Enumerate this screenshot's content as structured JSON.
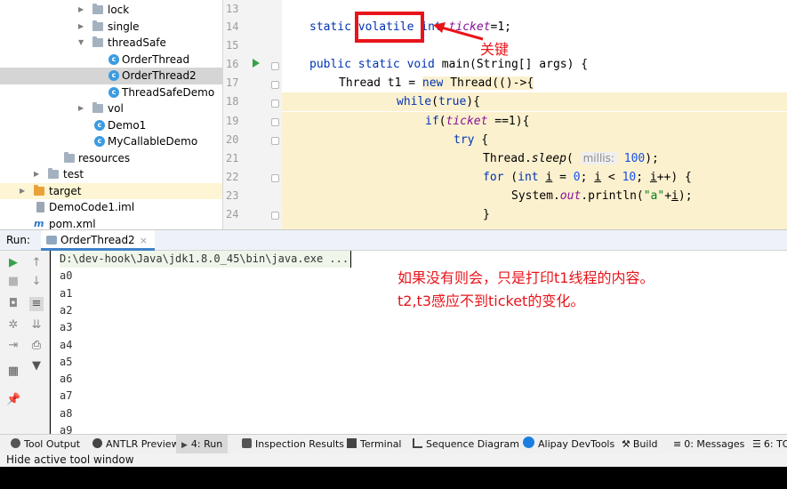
{
  "tree": {
    "items": [
      {
        "label": "lock",
        "kind": "folder"
      },
      {
        "label": "single",
        "kind": "folder"
      },
      {
        "label": "threadSafe",
        "kind": "folder"
      },
      {
        "label": "OrderThread",
        "kind": "class"
      },
      {
        "label": "OrderThread2",
        "kind": "class"
      },
      {
        "label": "ThreadSafeDemo",
        "kind": "class"
      },
      {
        "label": "vol",
        "kind": "folder"
      },
      {
        "label": "Demo1",
        "kind": "class"
      },
      {
        "label": "MyCallableDemo",
        "kind": "class"
      },
      {
        "label": "resources",
        "kind": "folder"
      },
      {
        "label": "test",
        "kind": "folder"
      },
      {
        "label": "target",
        "kind": "folder"
      },
      {
        "label": "DemoCode1.iml",
        "kind": "file"
      },
      {
        "label": "pom.xml",
        "kind": "maven"
      }
    ]
  },
  "editor": {
    "line_numbers": [
      "13",
      "14",
      "15",
      "16",
      "17",
      "18",
      "19",
      "20",
      "21",
      "22",
      "23",
      "24"
    ],
    "l14": {
      "static": "static ",
      "volatile": "volatile",
      "int": " int ",
      "field": "ticket",
      "rest": "=1;"
    },
    "l16": {
      "kw": "public static void ",
      "rest": "main(String[] args) {"
    },
    "l17": {
      "pre": "Thread t1 = ",
      "new": "new",
      "rest": " Thread(()->{"
    },
    "l18": {
      "kw": "while",
      "pre": "(",
      "true": "true",
      "rest": "){"
    },
    "l19": {
      "kw": "if",
      "pre": "(",
      "field": "ticket",
      "rest": " ==1){"
    },
    "l20": {
      "kw": "try",
      "rest": " {"
    },
    "l21": {
      "pre": "Thread.",
      "method": "sleep",
      "open": "(",
      "hint": "millis:",
      "num": "100",
      "rest": ");"
    },
    "l22": {
      "for": "for",
      "open": " (",
      "int": "int",
      "var1": "i",
      "eq": " = ",
      "zero": "0",
      "semi": "; ",
      "var2": "i",
      "lt": " < ",
      "ten": "10",
      "semi2": "; ",
      "var3": "i",
      "rest": "++) {"
    },
    "l23": {
      "pre": "System.",
      "out": "out",
      "mid": ".println(",
      "str": "\"a\"",
      "plus": "+",
      "var": "i",
      "rest": ");"
    },
    "l24": {
      "rest": "}"
    }
  },
  "annotation": {
    "key_label": "关键",
    "note_line1": "如果没有则会，只是打印t1线程的内容。",
    "note_line2": "t2,t3感应不到ticket的变化。"
  },
  "run": {
    "label": "Run:",
    "tab": "OrderThread2",
    "tab_close": "×",
    "command": "D:\\dev-hook\\Java\\jdk1.8.0_45\\bin\\java.exe ...",
    "output": [
      "a0",
      "a1",
      "a2",
      "a3",
      "a4",
      "a5",
      "a6",
      "a7",
      "a8",
      "a9"
    ]
  },
  "bottom_tools": {
    "tool_output": "Tool Output",
    "antlr": "ANTLR Preview",
    "run": "4: Run",
    "inspection": "Inspection Results",
    "terminal": "Terminal",
    "sequence": "Sequence Diagram",
    "alipay": "Alipay DevTools",
    "build": "Build",
    "messages": "0: Messages",
    "todo": "6: TO"
  },
  "status": {
    "text": "Hide active tool window"
  },
  "colors": {
    "annotation_red": "#e8141b",
    "keyword_blue": "#0033b3",
    "field_purple": "#871094",
    "number_blue": "#1750eb",
    "string_green": "#067d17",
    "highlight_yellow": "#fcf1cf",
    "run_green": "#39a14a"
  }
}
